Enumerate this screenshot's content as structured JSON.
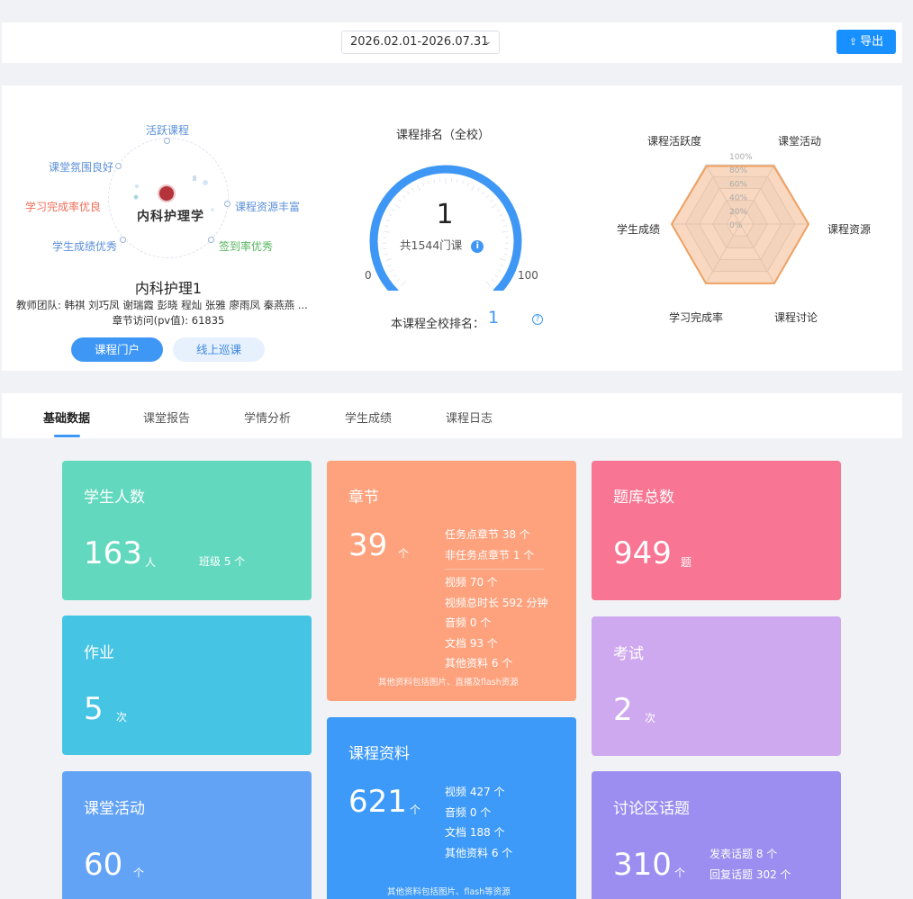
{
  "header": {
    "date_range": "2026.02.01-2026.07.31",
    "export_label": "导出"
  },
  "course": {
    "orbit_tags": {
      "active": "活跃课程",
      "atmosphere": "课堂氛围良好",
      "resources": "课程资源丰富",
      "completion": "学习完成率优良",
      "grades": "学生成绩优秀",
      "signin": "签到率优秀"
    },
    "logo_text": "内科护理学",
    "title": "内科护理1",
    "teachers": "教师团队: 韩祺 刘巧凤 谢瑞霞 彭晓 程灿 张雅 廖雨凤 秦燕燕 ...",
    "visits": "章节访问(pv值): 61835",
    "portal_button": "课程门户",
    "patrol_button": "线上巡课"
  },
  "ranking": {
    "title": "课程排名（全校）",
    "value": "1",
    "total": "共1544门课",
    "min": "0",
    "max": "100",
    "school_rank_label": "本课程全校排名：",
    "school_rank_value": "1",
    "gauge_fraction": 0.999
  },
  "radar": {
    "axes": [
      "课堂活动",
      "课程资源",
      "课程讨论",
      "学习完成率",
      "学生成绩",
      "课程活跃度"
    ],
    "values": [
      0.98,
      1.0,
      1.0,
      1.0,
      1.0,
      0.98
    ],
    "ticks": [
      "100%",
      "80%",
      "60%",
      "40%",
      "20%",
      "0%"
    ],
    "fill_color": "#f5a66a"
  },
  "tabs": [
    "基础数据",
    "课堂报告",
    "学情分析",
    "学生成绩",
    "课程日志"
  ],
  "cards": {
    "students": {
      "title": "学生人数",
      "value": "163",
      "unit": "人",
      "extra": "班级 5 个",
      "color": "#62d8be"
    },
    "homework": {
      "title": "作业",
      "value": "5",
      "unit": "次",
      "color": "#45c4e4"
    },
    "activities": {
      "title": "课堂活动",
      "value": "60",
      "unit": "个",
      "color": "#63a3f6"
    },
    "chapters": {
      "title": "章节",
      "value": "39",
      "unit": "个",
      "details1": [
        "任务点章节 38 个",
        "非任务点章节 1 个"
      ],
      "details2": [
        "视频 70 个",
        "视频总时长 592 分钟",
        "音频 0 个",
        "文档 93 个",
        "其他资料 6 个"
      ],
      "note": "其他资料包括图片、直播及flash资源",
      "color": "#fea27d"
    },
    "materials": {
      "title": "课程资料",
      "value": "621",
      "unit": "个",
      "details": [
        "视频 427 个",
        "音频 0 个",
        "文档 188 个",
        "其他资料 6 个"
      ],
      "note": "其他资料包括图片、flash等资源",
      "color": "#3e9af8"
    },
    "questions": {
      "title": "题库总数",
      "value": "949",
      "unit": "题",
      "color": "#f87593"
    },
    "exams": {
      "title": "考试",
      "value": "2",
      "unit": "次",
      "color": "#cfa9ef"
    },
    "discussion": {
      "title": "讨论区话题",
      "value": "310",
      "unit": "个",
      "details": [
        "发表话题 8 个",
        "回复话题 302 个"
      ],
      "color": "#9b8ef0"
    }
  }
}
